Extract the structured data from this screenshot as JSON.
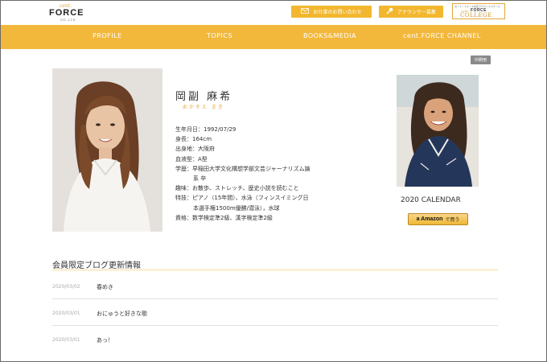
{
  "header": {
    "logo": {
      "cent": "cent.",
      "force": "FORCE",
      "co": "CO.,LTD"
    },
    "contact_button": "お仕事のお問い合わせ",
    "announcer_button": "アナウンサー募集",
    "college": {
      "tagline": "セント・フォース対応アナウンススクール",
      "cent": "cent.",
      "force": "FORCE",
      "college": "COLLEGE"
    }
  },
  "nav": {
    "items": [
      "PROFILE",
      "TOPICS",
      "BOOKS&MEDIA",
      "cent.FORCE CHANNEL"
    ]
  },
  "print_label": "印刷用",
  "profile": {
    "name": "岡副 麻希",
    "kana": "おかぞえ まき",
    "details": [
      "生年月日：1992/07/29",
      "身長：164cm",
      "出身地：大阪府",
      "血液型：A型",
      "学歴：早稲田大学文化構想学部文芸ジャーナリズム論",
      "系 卒",
      "趣味：お散歩、ストレッチ、歴史小説を読むこと",
      "特技：ピアノ（15年間）、水泳（フィンスイミング日",
      "本選手権1500m優勝/潜泳），水球",
      "資格：数学検定準2級、漢字検定準2級"
    ]
  },
  "calendar": {
    "title": "2020 CALENDAR",
    "amazon_logo": "a Amazon",
    "amazon_label": "で買う"
  },
  "blog": {
    "heading": "会員限定ブログ更新情報",
    "entries": [
      {
        "date": "2020/03/02",
        "title": "春めき"
      },
      {
        "date": "2020/03/01",
        "title": "おにゅうと好きな歌"
      },
      {
        "date": "2020/03/01",
        "title": "あっ！"
      }
    ]
  },
  "colors": {
    "accent": "#f2b83c",
    "kana": "#e3a73a",
    "print": "#8a8a8a"
  }
}
